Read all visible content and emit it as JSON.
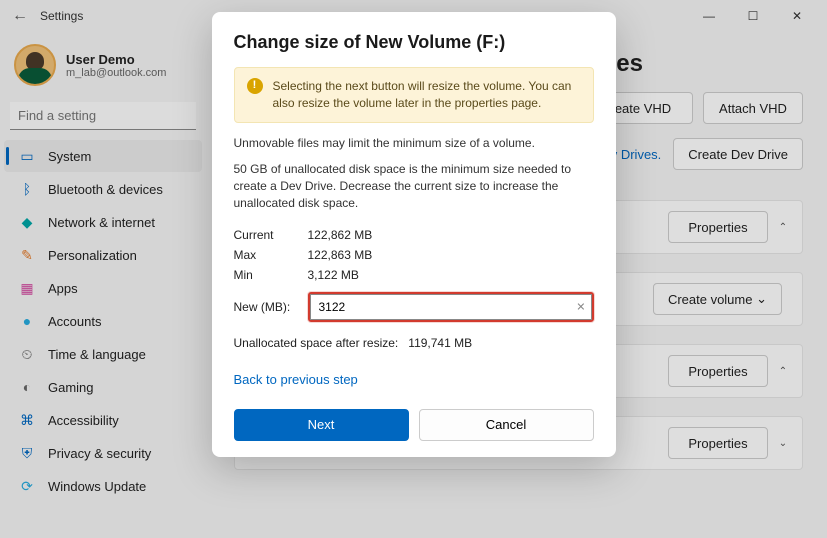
{
  "window": {
    "title": "Settings"
  },
  "user": {
    "name": "User Demo",
    "email": "m_lab@outlook.com"
  },
  "search": {
    "placeholder": "Find a setting"
  },
  "nav": [
    {
      "label": "System",
      "icon": "▭",
      "cls": "c-blue",
      "active": true
    },
    {
      "label": "Bluetooth & devices",
      "icon": "ᛒ",
      "cls": "c-blue"
    },
    {
      "label": "Network & internet",
      "icon": "◆",
      "cls": "c-teal"
    },
    {
      "label": "Personalization",
      "icon": "✎",
      "cls": "c-orange"
    },
    {
      "label": "Apps",
      "icon": "▦",
      "cls": "c-pink"
    },
    {
      "label": "Accounts",
      "icon": "●",
      "cls": "c-cyan"
    },
    {
      "label": "Time & language",
      "icon": "⏲",
      "cls": "c-gray"
    },
    {
      "label": "Gaming",
      "icon": "◐",
      "cls": "c-gray"
    },
    {
      "label": "Accessibility",
      "icon": "⌘",
      "cls": "c-blue"
    },
    {
      "label": "Privacy & security",
      "icon": "⛨",
      "cls": "c-blue"
    },
    {
      "label": "Windows Update",
      "icon": "⟳",
      "cls": "c-cyan"
    }
  ],
  "content": {
    "heading_suffix": "mes",
    "create_vhd": "eate VHD",
    "attach_vhd": "Attach VHD",
    "dev_drives_link": "Dev Drives.",
    "create_dev_drive": "Create Dev Drive",
    "properties": "Properties",
    "create_volume": "Create volume"
  },
  "dialog": {
    "title": "Change size of New Volume (F:)",
    "banner": "Selecting the next button will resize the volume. You can also resize the volume later in the properties page.",
    "hint1": "Unmovable files may limit the minimum size of a volume.",
    "hint2": "50 GB of unallocated disk space is the minimum size needed to create a Dev Drive. Decrease the current size to increase the unallocated disk space.",
    "current_label": "Current",
    "current_value": "122,862 MB",
    "max_label": "Max",
    "max_value": "122,863 MB",
    "min_label": "Min",
    "min_value": "3,122 MB",
    "new_label": "New (MB):",
    "new_value": "3122",
    "unalloc_label": "Unallocated space after resize:",
    "unalloc_value": "119,741 MB",
    "back_link": "Back to previous step",
    "next": "Next",
    "cancel": "Cancel"
  }
}
